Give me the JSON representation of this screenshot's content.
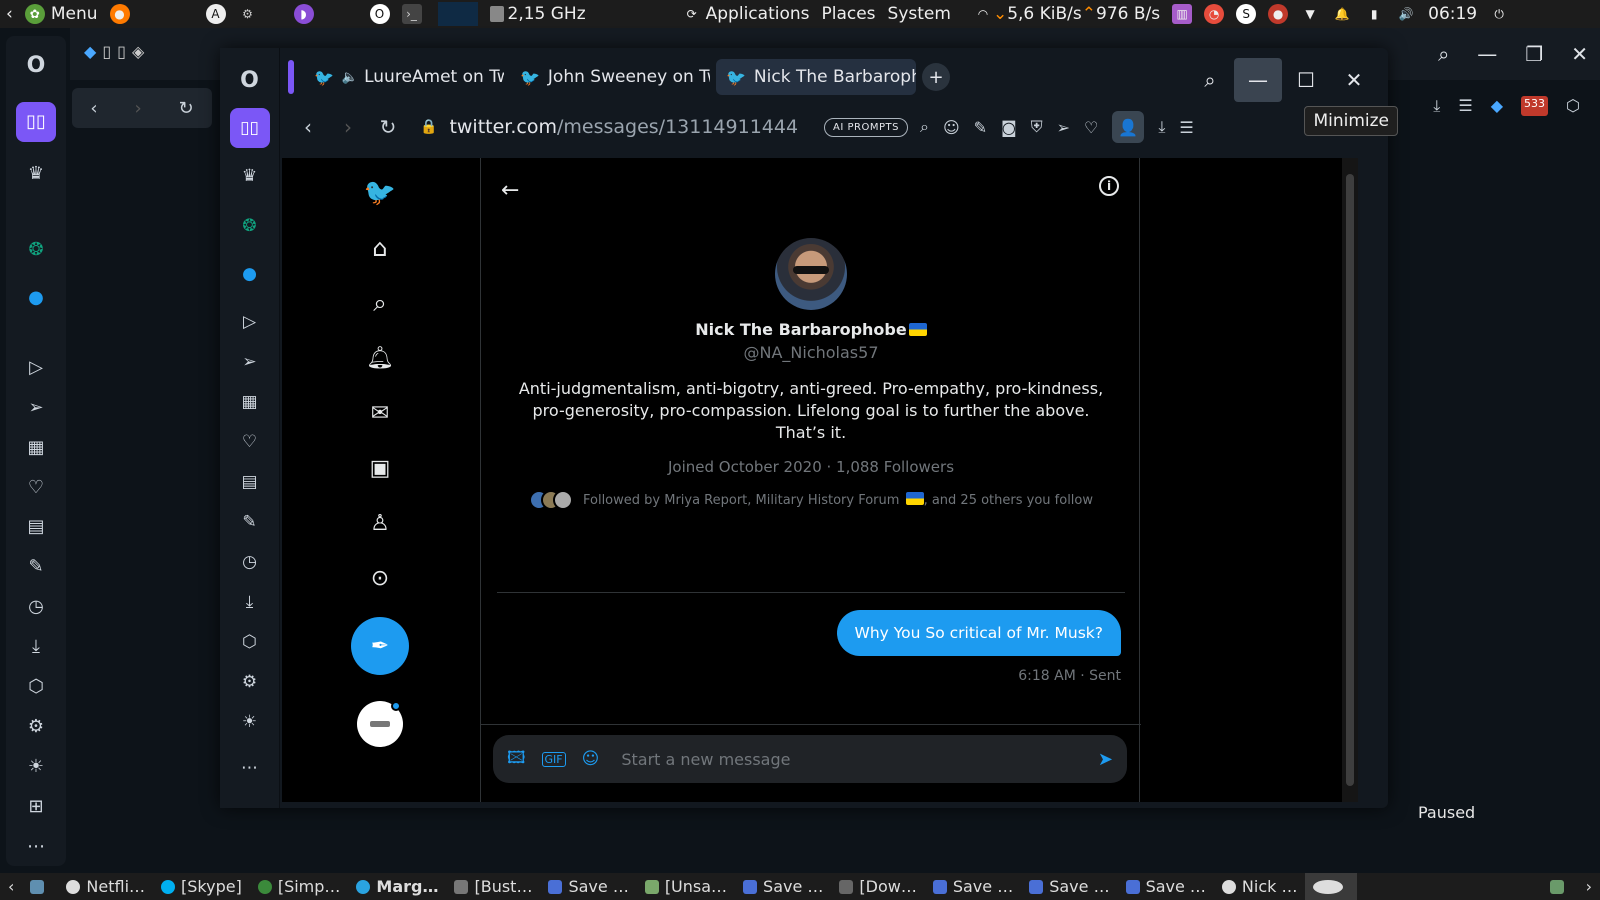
{
  "system_panel": {
    "menu_label": "Menu",
    "cpu_freq": "2,15 GHz",
    "applications": "Applications",
    "places": "Places",
    "system": "System",
    "down_speed": "5,6 KiB/s",
    "up_speed": "976 B/s",
    "clock": "06:19"
  },
  "browser": {
    "tabs": [
      {
        "label": "LuureAmet on Tw"
      },
      {
        "label": "John Sweeney on Tw"
      },
      {
        "label": "Nick The Barbaropho"
      }
    ],
    "url_host": "twitter.com",
    "url_path": "/messages/13114911444",
    "ai_prompts": "AI PROMPTS",
    "minimize_tooltip": "Minimize"
  },
  "conversation": {
    "name": "Nick The Barbarophobe",
    "handle": "@NA_Nicholas57",
    "bio": "Anti-judgmentalism, anti-bigotry, anti-greed. Pro-empathy, pro-kindness, pro-generosity, pro-compassion. Lifelong goal is to further the above. That’s it.",
    "joined": "Joined October 2020 · 1,088 Followers",
    "followed_by": "Followed by Mriya Report, Military History Forum",
    "followed_by_suffix": ", and 25 others you follow",
    "message": "Why You So critical of Mr. Musk?",
    "message_meta": "6:18 AM · Sent",
    "composer_placeholder": "Start a new message"
  },
  "background": {
    "paused_label": "Paused"
  },
  "taskbar": {
    "items": [
      {
        "label": "Netfli…"
      },
      {
        "label": "[Skype]"
      },
      {
        "label": "[Simp…"
      },
      {
        "label": "Marg…"
      },
      {
        "label": "[Bust…"
      },
      {
        "label": "Save …"
      },
      {
        "label": "[Unsa…"
      },
      {
        "label": "Save …"
      },
      {
        "label": "[Dow…"
      },
      {
        "label": "Save …"
      },
      {
        "label": "Save …"
      },
      {
        "label": "Save …"
      },
      {
        "label": "Nick …"
      }
    ]
  },
  "colors": {
    "twitter_blue": "#1d9bf0",
    "panel": "#1c1c1c"
  }
}
